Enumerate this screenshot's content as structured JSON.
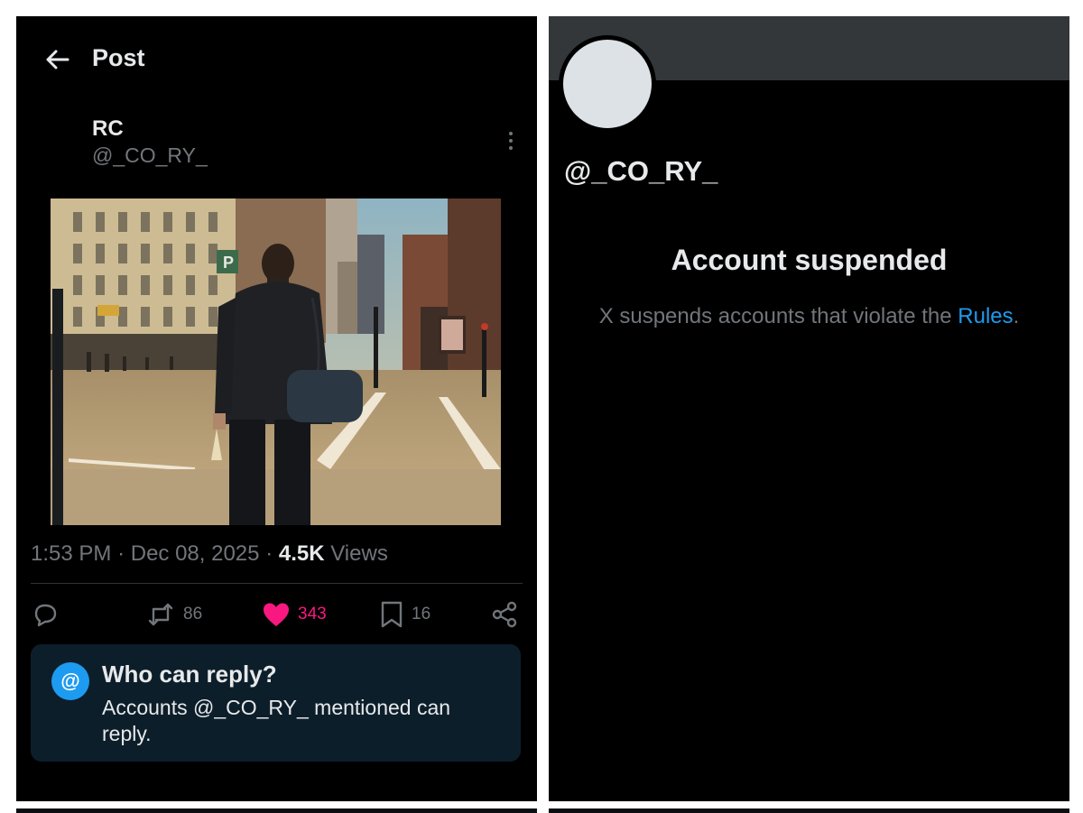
{
  "post_view": {
    "header": {
      "title": "Post"
    },
    "author": {
      "name": "RC",
      "handle": "@_CO_RY_"
    },
    "timestamp": {
      "time": "1:53 PM",
      "date": "Dec 08, 2025"
    },
    "views": {
      "count": "4.5K",
      "label": "Views"
    },
    "actions": {
      "reply": {
        "icon": "reply-icon"
      },
      "repost": {
        "count": "86",
        "icon": "repost-icon"
      },
      "like": {
        "count": "343",
        "icon": "heart-icon",
        "color": "#f91880"
      },
      "bookmark": {
        "count": "16",
        "icon": "bookmark-icon"
      },
      "share": {
        "icon": "share-icon"
      }
    },
    "reply_settings": {
      "icon_glyph": "@",
      "title": "Who can reply?",
      "prefix": "Accounts ",
      "handle": "@_CO_RY_",
      "suffix": " mentioned can reply."
    }
  },
  "profile_view": {
    "handle": "@_CO_RY_",
    "status_title": "Account suspended",
    "status_text": "X suspends accounts that violate the ",
    "link_text": "Rules",
    "trailing": "."
  },
  "colors": {
    "background": "#000000",
    "text_primary": "#e7e9ea",
    "text_secondary": "#71767b",
    "accent": "#1d9bf0",
    "like": "#f91880",
    "reply_card_bg": "#0d1e2b",
    "banner": "#33373a",
    "avatar_placeholder": "#dde2e6"
  }
}
